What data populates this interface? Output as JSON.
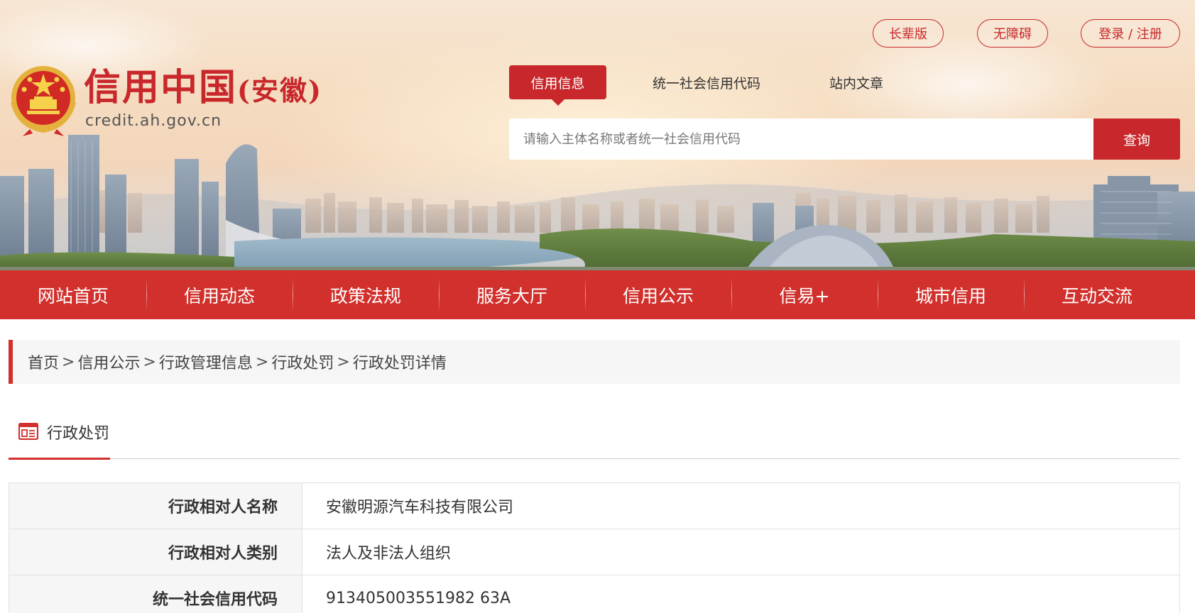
{
  "site": {
    "logo_title": "信用中国",
    "logo_province": "(安徽)",
    "logo_domain": "credit.ah.gov.cn"
  },
  "top_links": {
    "elder": "长辈版",
    "accessible": "无障碍",
    "login": "登录 / 注册"
  },
  "search": {
    "tabs": [
      "信用信息",
      "统一社会信用代码",
      "站内文章"
    ],
    "active_tab": "信用信息",
    "placeholder": "请输入主体名称或者统一社会信用代码",
    "button": "查询"
  },
  "nav": {
    "items": [
      "网站首页",
      "信用动态",
      "政策法规",
      "服务大厅",
      "信用公示",
      "信易+",
      "城市信用",
      "互动交流"
    ]
  },
  "breadcrumb": {
    "items": [
      "首页",
      "信用公示",
      "行政管理信息",
      "行政处罚",
      "行政处罚详情"
    ],
    "separator": ">"
  },
  "section": {
    "title": "行政处罚",
    "icon": "document-list-icon"
  },
  "details": {
    "rows": [
      {
        "label": "行政相对人名称",
        "value": "安徽明源汽车科技有限公司"
      },
      {
        "label": "行政相对人类别",
        "value": "法人及非法人组织"
      },
      {
        "label": "统一社会信用代码",
        "value": "913405003551982 63A"
      }
    ]
  },
  "colors": {
    "brand_red": "#c8282b",
    "nav_red": "#d1302c",
    "breadcrumb_bg": "#f6f6f6",
    "text": "#333333"
  }
}
